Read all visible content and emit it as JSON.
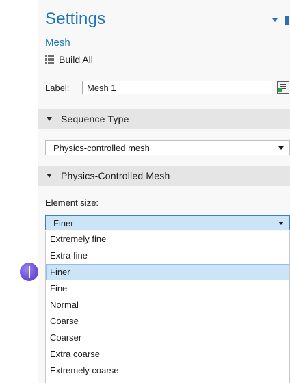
{
  "header": {
    "title": "Settings",
    "node_name": "Mesh"
  },
  "toolbar": {
    "build_all_label": "Build All",
    "build_icon": "build-all-icon"
  },
  "label_field": {
    "caption": "Label:",
    "value": "Mesh 1",
    "icon": "label-info-icon"
  },
  "sections": {
    "sequence_type": {
      "title": "Sequence Type",
      "selected": "Physics-controlled mesh"
    },
    "physics_controlled_mesh": {
      "title": "Physics-Controlled Mesh",
      "element_size_label": "Element size:",
      "selected": "Finer",
      "options": [
        "Extremely fine",
        "Extra fine",
        "Finer",
        "Fine",
        "Normal",
        "Coarse",
        "Coarser",
        "Extra coarse",
        "Extremely coarse"
      ]
    }
  },
  "colors": {
    "accent": "#1e74b8",
    "selected_bg": "#cce4f7",
    "section_bg": "#e5e5e5",
    "cursor_marker": "#6a4fd6"
  }
}
